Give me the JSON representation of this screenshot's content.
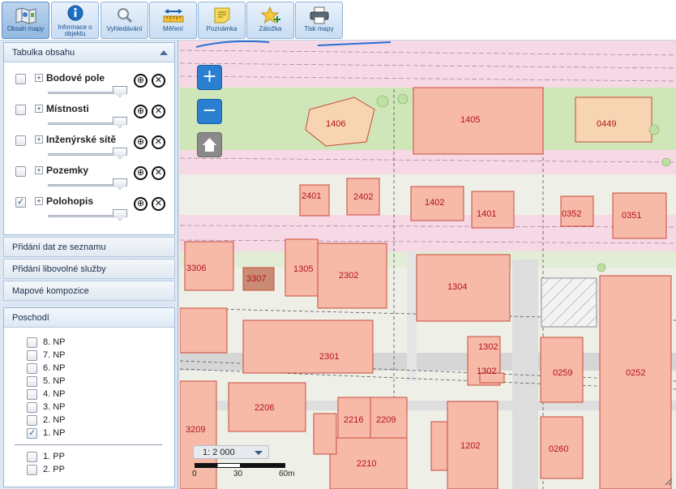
{
  "toolbar": {
    "items": [
      {
        "label": "Obsah mapy",
        "icon": "map-icon",
        "active": true
      },
      {
        "label": "Informace o objektu",
        "icon": "info-icon"
      },
      {
        "label": "Vyhledávání",
        "icon": "search-icon"
      },
      {
        "label": "Měření",
        "icon": "ruler-icon"
      },
      {
        "label": "Poznámka",
        "icon": "note-icon"
      },
      {
        "label": "Záložka",
        "icon": "star-icon"
      },
      {
        "label": "Tisk mapy",
        "icon": "print-icon"
      }
    ]
  },
  "toc": {
    "title": "Tabulka obsahu",
    "layers": [
      {
        "name": "Bodové pole",
        "checked": false
      },
      {
        "name": "Místnosti",
        "checked": false
      },
      {
        "name": "Inženýrské sítě",
        "checked": false
      },
      {
        "name": "Pozemky",
        "checked": false
      },
      {
        "name": "Polohopis",
        "checked": true
      }
    ]
  },
  "sections": [
    "Přidání dat ze seznamu",
    "Přidání libovolné služby",
    "Mapové kompozice"
  ],
  "floors": {
    "title": "Poschodí",
    "above": [
      {
        "label": "8. NP",
        "checked": false
      },
      {
        "label": "7. NP",
        "checked": false
      },
      {
        "label": "6. NP",
        "checked": false
      },
      {
        "label": "5. NP",
        "checked": false
      },
      {
        "label": "4. NP",
        "checked": false
      },
      {
        "label": "3. NP",
        "checked": false
      },
      {
        "label": "2. NP",
        "checked": false
      },
      {
        "label": "1. NP",
        "checked": true
      }
    ],
    "below": [
      {
        "label": "1. PP",
        "checked": false
      },
      {
        "label": "2. PP",
        "checked": false
      }
    ]
  },
  "map": {
    "zoom_in": "+",
    "zoom_out": "−",
    "scale_value": "1: 2 000",
    "scale_labels": [
      "0",
      "30",
      "60m"
    ],
    "building_labels": [
      "1406",
      "1405",
      "0449",
      "2401",
      "2402",
      "1402",
      "1401",
      "0352",
      "0351",
      "3306",
      "3307",
      "1305",
      "2302",
      "1304",
      "2301",
      "1302",
      "1302",
      "0259",
      "0252",
      "2206",
      "2216",
      "2209",
      "3209",
      "1202",
      "0260",
      "2210"
    ]
  },
  "colors": {
    "building_fill": "#f7b9a8",
    "building_stroke": "#c84b3a",
    "building_text": "#b3141a",
    "road_pink": "#f7d9e6",
    "green": "#cfe6b8",
    "accent": "#2a7fd1"
  }
}
